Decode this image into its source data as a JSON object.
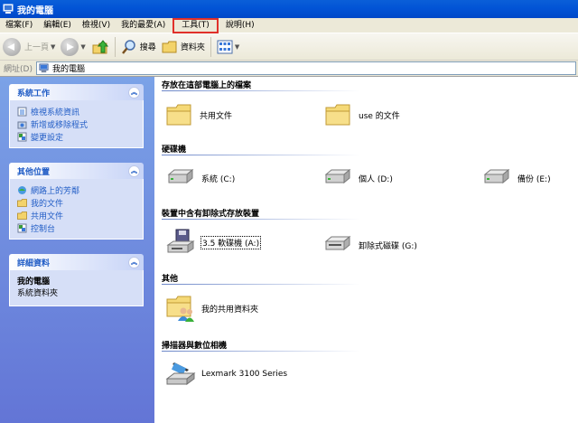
{
  "window": {
    "title": "我的電腦"
  },
  "menu": [
    "檔案(F)",
    "編輯(E)",
    "檢視(V)",
    "我的最愛(A)",
    "工具(T)",
    "說明(H)"
  ],
  "toolbar": {
    "back_label": "上一頁",
    "search_label": "搜尋",
    "folders_label": "資料夾"
  },
  "address": {
    "label": "網址(D)",
    "value": "我的電腦"
  },
  "left": {
    "system_tasks": {
      "title": "系統工作",
      "items": [
        "檢視系統資訊",
        "新增或移除程式",
        "變更設定"
      ]
    },
    "other_places": {
      "title": "其他位置",
      "items": [
        "網路上的芳鄰",
        "我的文件",
        "共用文件",
        "控制台"
      ]
    },
    "details": {
      "title": "詳細資料",
      "name": "我的電腦",
      "type": "系統資料夾"
    }
  },
  "content": {
    "groups": [
      {
        "title": "存放在這部電腦上的檔案",
        "items": [
          "共用文件",
          "use 的文件"
        ]
      },
      {
        "title": "硬碟機",
        "items": [
          "系統 (C:)",
          "個人 (D:)",
          "備份 (E:)"
        ]
      },
      {
        "title": "裝置中含有卸除式存放裝置",
        "items": [
          "3.5 軟碟機 (A:)",
          "卸除式磁碟 (G:)"
        ]
      },
      {
        "title": "其他",
        "items": [
          "我的共用資料夾"
        ]
      },
      {
        "title": "掃描器與數位相機",
        "items": [
          "Lexmark 3100 Series"
        ]
      }
    ]
  },
  "colors": {
    "titlebar": "#0254d6",
    "task_link": "#215dc6",
    "menu_highlight": "#e0302a"
  }
}
